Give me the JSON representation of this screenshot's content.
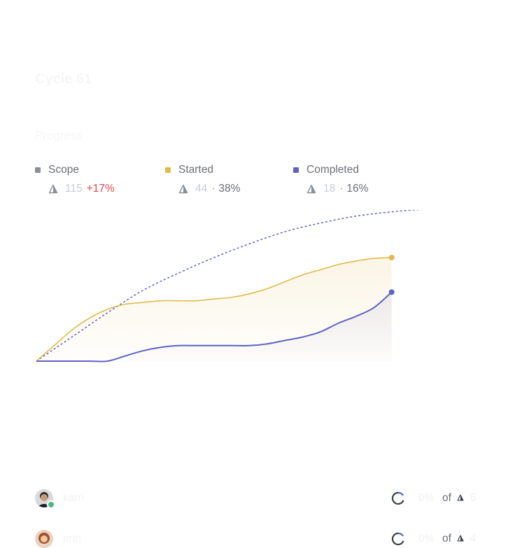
{
  "cycle": {
    "title": "Cycle 61"
  },
  "progress": {
    "section_title": "Progress",
    "legend": [
      {
        "label": "Scope",
        "count": "115",
        "delta": "+17%",
        "color": "#8a8f98",
        "icon": "estimate-icon"
      },
      {
        "label": "Started",
        "count": "44",
        "separator": "·",
        "percent": "38%",
        "color": "#e2b94a",
        "icon": "estimate-icon"
      },
      {
        "label": "Completed",
        "count": "18",
        "separator": "·",
        "percent": "16%",
        "color": "#5e63c4",
        "icon": "estimate-icon"
      }
    ]
  },
  "chart_data": {
    "type": "line",
    "title": "",
    "xlabel": "",
    "ylabel": "",
    "x": [
      0,
      1,
      2,
      3,
      4,
      5,
      6,
      7,
      8,
      9,
      10,
      11,
      12,
      13,
      14,
      15,
      16,
      17,
      18,
      19,
      20
    ],
    "xlim": [
      0,
      24.5
    ],
    "ylim": [
      0,
      60
    ],
    "grid": false,
    "legend": "none",
    "series": [
      {
        "name": "Started",
        "color": "#e2b94a",
        "fill": true,
        "end_marker": true,
        "values": [
          0,
          9,
          18,
          25,
          30,
          33,
          34,
          35,
          35,
          35,
          36,
          37,
          39,
          42,
          46,
          50,
          53,
          56,
          58,
          59.5,
          60
        ]
      },
      {
        "name": "Completed",
        "color": "#5e63c4",
        "fill": true,
        "end_marker": true,
        "values": [
          0,
          0,
          0,
          0,
          0,
          3,
          6,
          8,
          9,
          9,
          9,
          9,
          9,
          10,
          12,
          14,
          17,
          22,
          26,
          31,
          40
        ]
      },
      {
        "name": "Scope",
        "color": "#5e63c4",
        "dashed": true,
        "x": [
          0,
          2,
          4,
          6,
          8,
          10,
          12,
          14,
          16,
          18,
          20,
          22,
          24.5
        ],
        "values": [
          0,
          14,
          28,
          41,
          51,
          60,
          68,
          75,
          80,
          84,
          86.5,
          88,
          88.5
        ]
      }
    ]
  },
  "assignees": [
    {
      "name": "karri",
      "percent": "0%",
      "of_label": "of",
      "count": "6",
      "ring_color": "#5e63c4"
    },
    {
      "name": "erin",
      "percent": "0%",
      "of_label": "of",
      "count": "4",
      "ring_color": "#5e63c4"
    }
  ]
}
